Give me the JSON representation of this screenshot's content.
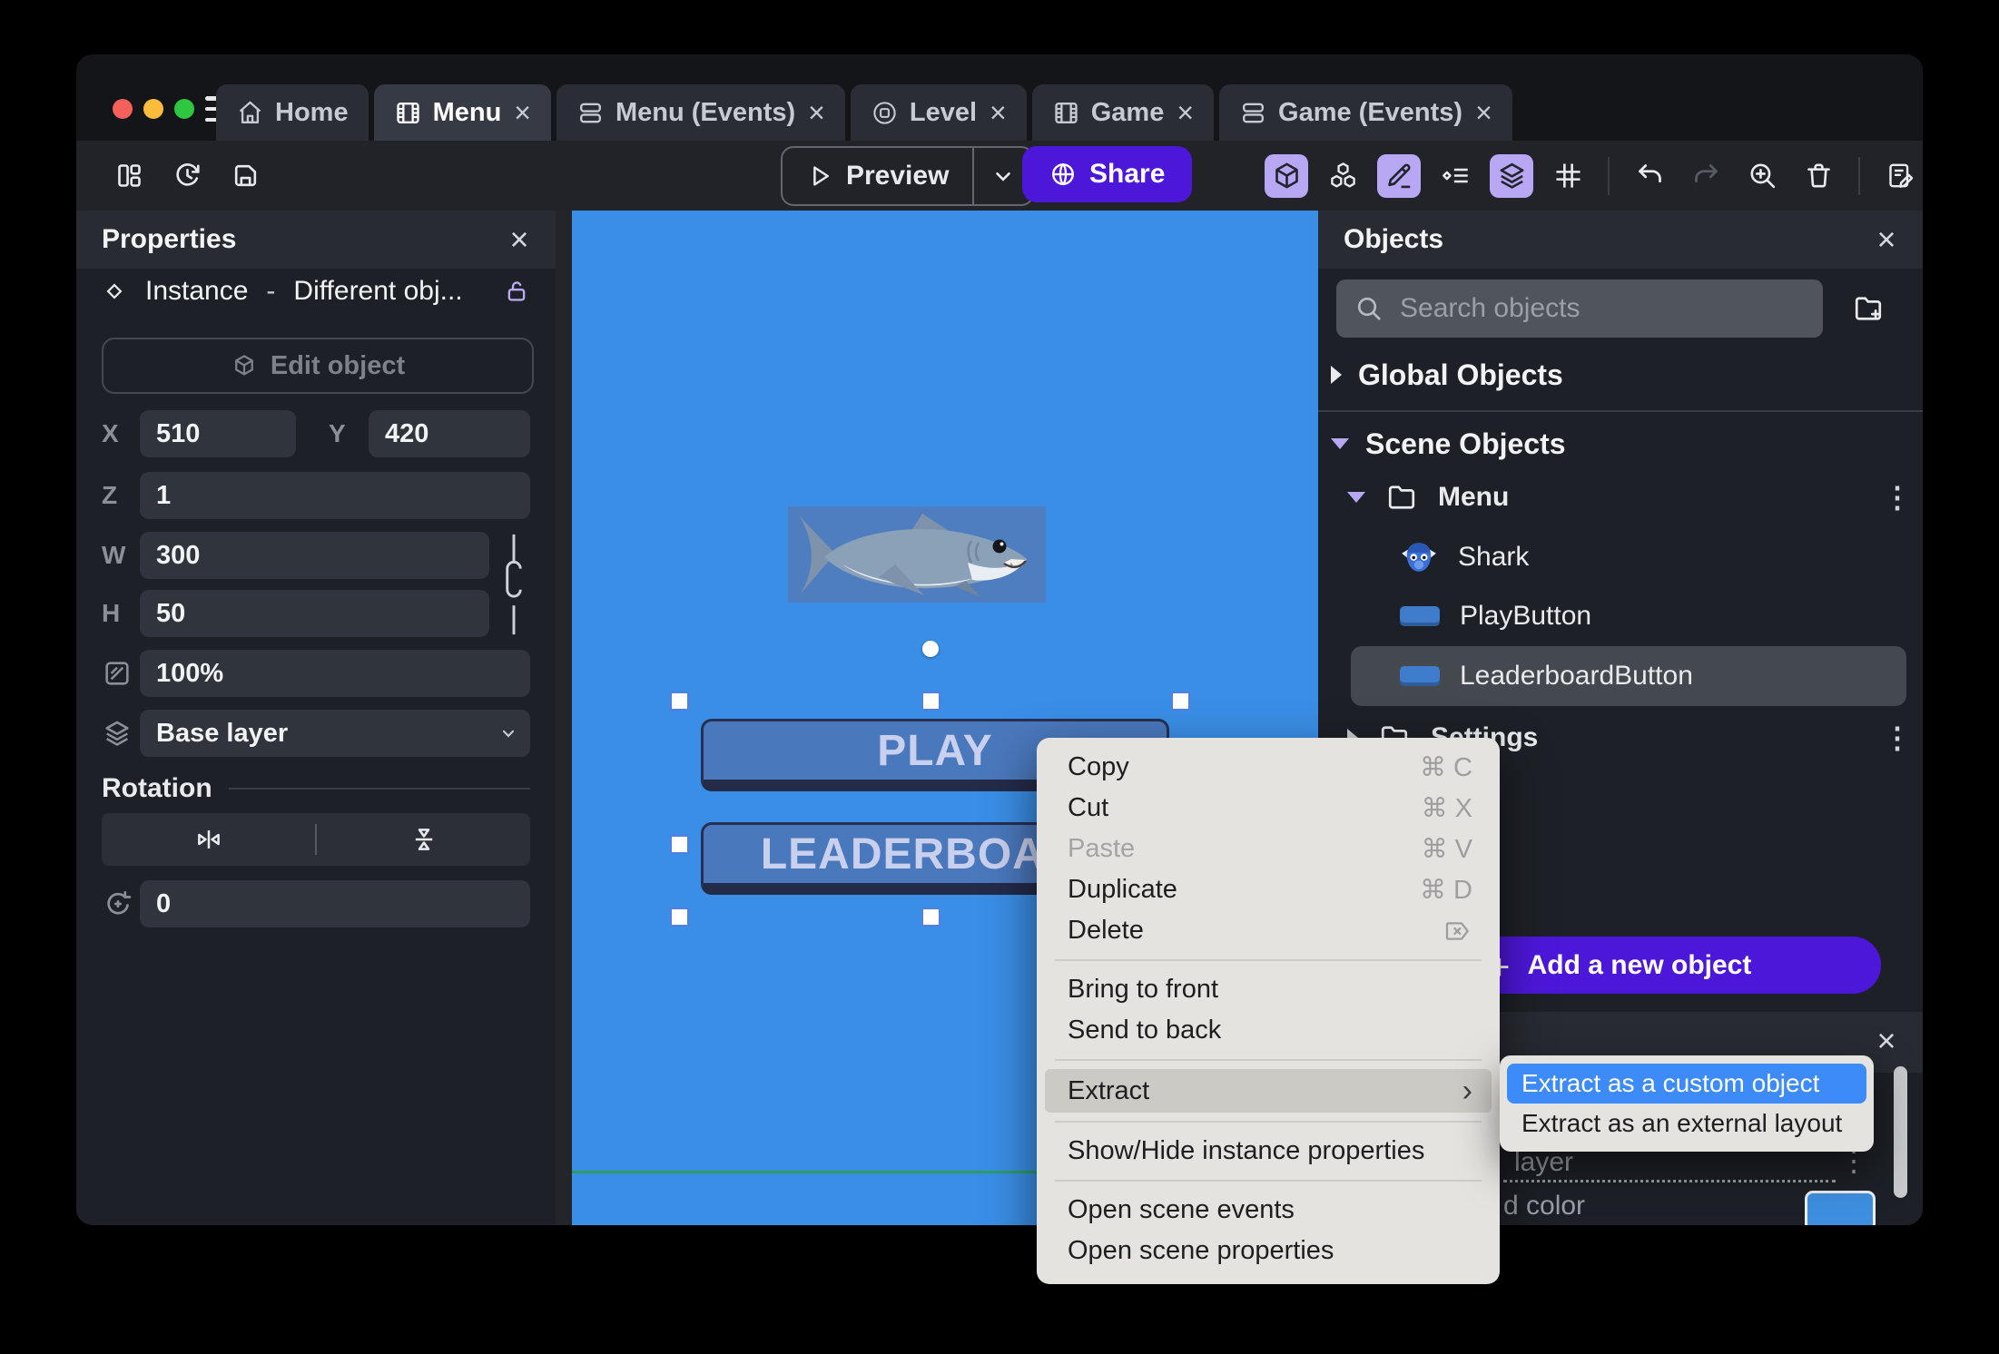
{
  "icons": {
    "close": "×",
    "kebab": "⋮",
    "plus": "+",
    "chevron_right": "›"
  },
  "colors": {
    "accent_purple": "#4D17DA",
    "active_tool_bg": "#B8A7F2",
    "canvas_blue": "#3A8EE6",
    "selection_blue": "#3D8BF8",
    "scene_button_blue": "#4A78BC",
    "scene_bound_green": "#2C9C64",
    "swatch_style": "background:#3E8FE0"
  },
  "titlebar": {
    "tabs": [
      {
        "label": "Home",
        "icon": "home-icon",
        "active": false,
        "closable": false
      },
      {
        "label": "Menu",
        "icon": "scene-icon",
        "active": true,
        "closable": true
      },
      {
        "label": "Menu (Events)",
        "icon": "events-icon",
        "active": false,
        "closable": true
      },
      {
        "label": "Level",
        "icon": "level-icon",
        "active": false,
        "closable": true
      },
      {
        "label": "Game",
        "icon": "scene-icon",
        "active": false,
        "closable": true
      },
      {
        "label": "Game (Events)",
        "icon": "events-icon",
        "active": false,
        "closable": true
      }
    ]
  },
  "toolbar": {
    "preview_label": "Preview",
    "share_label": "Share"
  },
  "properties": {
    "title": "Properties",
    "instance_type": "Instance",
    "dash": "-",
    "instance_object": "Different obj...",
    "edit_object_label": "Edit object",
    "x_label": "X",
    "x_value": "510",
    "y_label": "Y",
    "y_value": "420",
    "z_label": "Z",
    "z_value": "1",
    "w_label": "W",
    "w_value": "300",
    "h_label": "H",
    "h_value": "50",
    "opacity_value": "100%",
    "layer_value": "Base layer",
    "rotation_title": "Rotation",
    "rotation_value": "0"
  },
  "canvas": {
    "play_label": "PLAY",
    "leaderboard_label": "LEADERBOARD"
  },
  "objects": {
    "title": "Objects",
    "search_placeholder": "Search objects",
    "global_header": "Global Objects",
    "scene_header": "Scene Objects",
    "tree": [
      {
        "label": "Menu",
        "type": "folder",
        "expanded": true
      },
      {
        "label": "Shark",
        "type": "sprite"
      },
      {
        "label": "PlayButton",
        "type": "button"
      },
      {
        "label": "LeaderboardButton",
        "type": "button",
        "selected": true
      },
      {
        "label": "Settings",
        "type": "folder",
        "expanded": false
      }
    ],
    "add_button_label": "Add a new object"
  },
  "layers_panel": {
    "layer_row_text": "layer",
    "color_row_text": "d color"
  },
  "context_menu": {
    "items": [
      {
        "label": "Copy",
        "shortcut": "⌘ C"
      },
      {
        "label": "Cut",
        "shortcut": "⌘ X"
      },
      {
        "label": "Paste",
        "shortcut": "⌘ V",
        "disabled": true
      },
      {
        "label": "Duplicate",
        "shortcut": "⌘ D"
      },
      {
        "label": "Delete",
        "shortcut": ""
      },
      {
        "label": "Bring to front"
      },
      {
        "label": "Send to back"
      },
      {
        "label": "Extract",
        "has_submenu": true,
        "highlighted": true
      },
      {
        "label": "Show/Hide instance properties"
      },
      {
        "label": "Open scene events"
      },
      {
        "label": "Open scene properties"
      }
    ]
  },
  "submenu": {
    "items": [
      {
        "label": "Extract as a custom object",
        "highlighted": true
      },
      {
        "label": "Extract as an external layout"
      }
    ]
  }
}
